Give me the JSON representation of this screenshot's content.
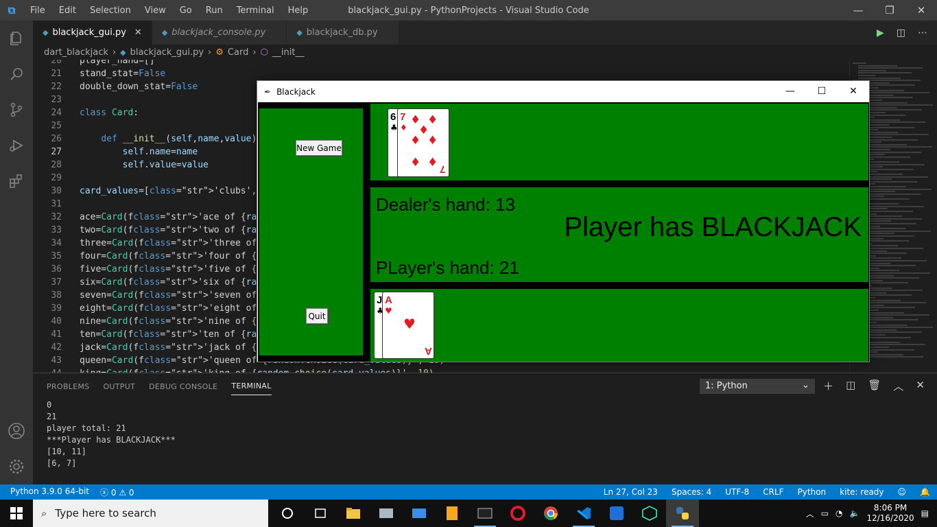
{
  "titlebar": {
    "menu": [
      "File",
      "Edit",
      "Selection",
      "View",
      "Go",
      "Run",
      "Terminal",
      "Help"
    ],
    "window_title": "blackjack_gui.py - PythonProjects - Visual Studio Code"
  },
  "tabs": [
    {
      "label": "blackjack_gui.py",
      "active": true
    },
    {
      "label": "blackjack_console.py",
      "active": false
    },
    {
      "label": "blackjack_db.py",
      "active": false
    }
  ],
  "breadcrumb": [
    "dart_blackjack",
    "blackjack_gui.py",
    "Card",
    "__init__"
  ],
  "editor": {
    "lines": [
      {
        "n": "20",
        "text": "player_hand=[]"
      },
      {
        "n": "21",
        "text": "stand_stat=False"
      },
      {
        "n": "22",
        "text": "double_down_stat=False"
      },
      {
        "n": "23",
        "text": ""
      },
      {
        "n": "24",
        "text": "class Card:"
      },
      {
        "n": "25",
        "text": ""
      },
      {
        "n": "26",
        "text": "    def __init__(self,name,value):"
      },
      {
        "n": "27",
        "text": "        self.name=name"
      },
      {
        "n": "28",
        "text": "        self.value=value"
      },
      {
        "n": "29",
        "text": ""
      },
      {
        "n": "30",
        "text": "card_values=['clubs','spades','hearts','diamonds']"
      },
      {
        "n": "31",
        "text": ""
      },
      {
        "n": "32",
        "text": "ace=Card(f'ace of {random.choice(card_values)}', 11)"
      },
      {
        "n": "33",
        "text": "two=Card(f'two of {random.choice(card_values)}', 2)"
      },
      {
        "n": "34",
        "text": "three=Card(f'three of {random.choice(card_values)}', 3)"
      },
      {
        "n": "35",
        "text": "four=Card(f'four of {random.choice(card_values)}', 4)"
      },
      {
        "n": "36",
        "text": "five=Card(f'five of {random.choice(card_values)}', 5)"
      },
      {
        "n": "37",
        "text": "six=Card(f'six of {random.choice(card_values)}', 6)"
      },
      {
        "n": "38",
        "text": "seven=Card(f'seven of {random.choice(card_values)}', 7)"
      },
      {
        "n": "39",
        "text": "eight=Card(f'eight of {random.choice(card_values)}', 8)"
      },
      {
        "n": "40",
        "text": "nine=Card(f'nine of {random.choice(card_values)}', 9)"
      },
      {
        "n": "41",
        "text": "ten=Card(f'ten of {random.choice(card_values)}', 10)"
      },
      {
        "n": "42",
        "text": "jack=Card(f'jack of {random.choice(card_values)}', 10)"
      },
      {
        "n": "43",
        "text": "queen=Card(f'queen of {random.choice(card_values)}', 10)"
      },
      {
        "n": "44",
        "text": "king=Card(f'king of {random.choice(card_values)}', 10)"
      }
    ],
    "current_line": "27"
  },
  "panel": {
    "tabs": [
      "PROBLEMS",
      "OUTPUT",
      "DEBUG CONSOLE",
      "TERMINAL"
    ],
    "active_tab": "TERMINAL",
    "terminal_select": "1: Python",
    "terminal_lines": [
      "0",
      "21",
      "player total: 21",
      "***Player has BLACKJACK***",
      "[10, 11]",
      "[6, 7]"
    ]
  },
  "statusbar": {
    "interpreter": "Python 3.9.0 64-bit",
    "errors": "0",
    "warnings": "0",
    "position": "Ln 27, Col 23",
    "spaces": "Spaces: 4",
    "encoding": "UTF-8",
    "eol": "CRLF",
    "language": "Python",
    "kite": "kite: ready"
  },
  "blackjack_window": {
    "title": "Blackjack",
    "new_game_label": "New Game",
    "quit_label": "Quit",
    "dealer_text": "Dealer's hand: 13",
    "result_text": "Player has BLACKJACK",
    "player_text": "PLayer's hand: 21",
    "dealer_cards": [
      {
        "rank": "6",
        "suit": "♣"
      },
      {
        "rank": "7",
        "suit": "♦"
      }
    ],
    "player_cards": [
      {
        "rank": "J",
        "suit": "♣"
      },
      {
        "rank": "A",
        "suit": "♥"
      }
    ]
  },
  "taskbar": {
    "search_placeholder": "Type here to search",
    "time": "8:06 PM",
    "date": "12/16/2020"
  },
  "colors": {
    "accent": "#007acc",
    "table_green": "#008000",
    "card_red": "#e31b23"
  }
}
